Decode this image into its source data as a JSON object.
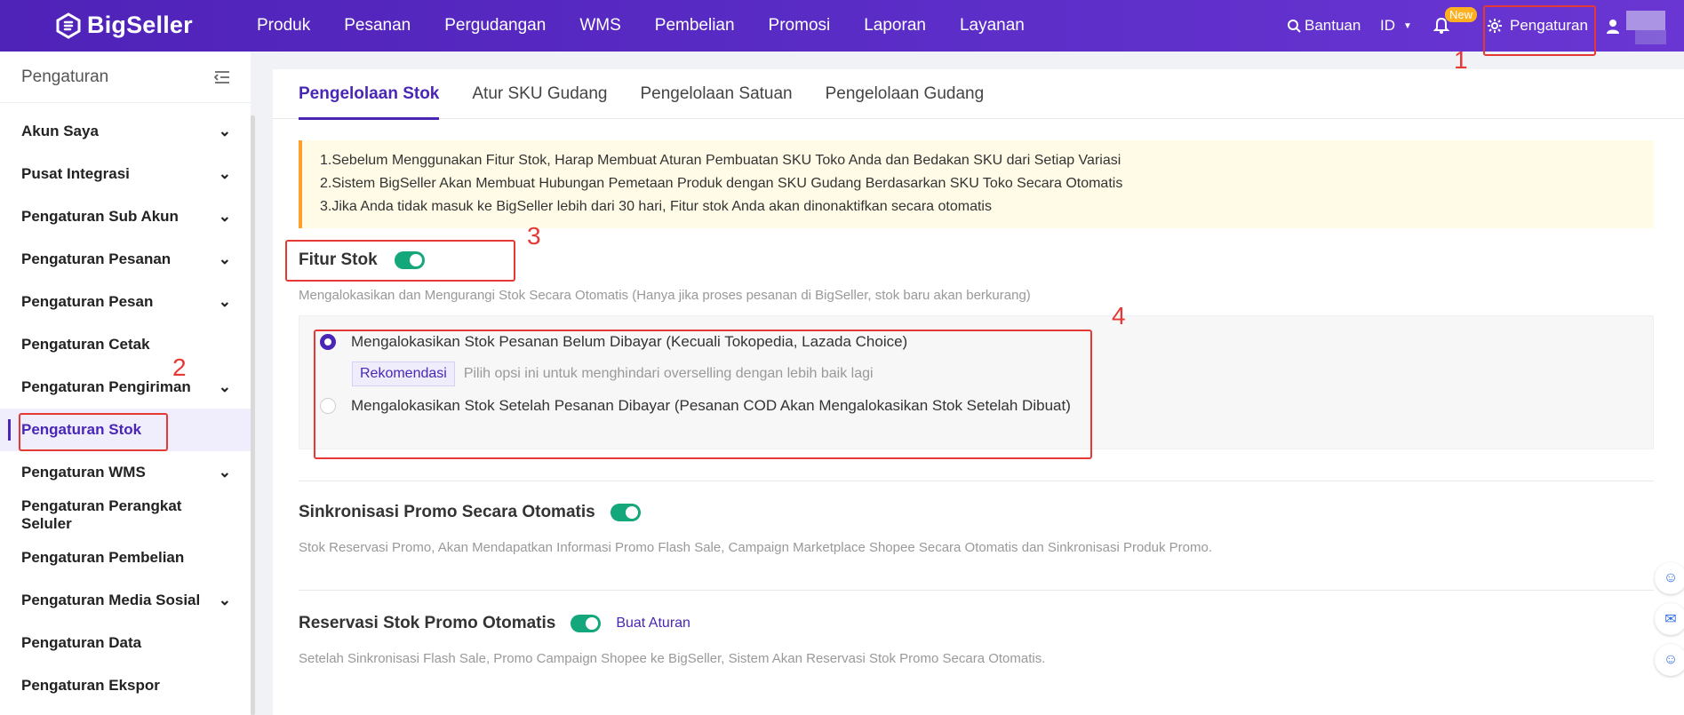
{
  "header": {
    "logo_text": "BigSeller",
    "nav": [
      "Produk",
      "Pesanan",
      "Pergudangan",
      "WMS",
      "Pembelian",
      "Promosi",
      "Laporan",
      "Layanan"
    ],
    "help_label": "Bantuan",
    "language": "ID",
    "new_badge": "New",
    "settings_label": "Pengaturan"
  },
  "sidebar": {
    "title": "Pengaturan",
    "items": [
      {
        "label": "Akun Saya"
      },
      {
        "label": "Pusat Integrasi"
      },
      {
        "label": "Pengaturan Sub Akun"
      },
      {
        "label": "Pengaturan Pesanan"
      },
      {
        "label": "Pengaturan Pesan"
      },
      {
        "label": "Pengaturan Cetak"
      },
      {
        "label": "Pengaturan Pengiriman"
      },
      {
        "label": "Pengaturan Stok"
      },
      {
        "label": "Pengaturan WMS"
      },
      {
        "label": "Pengaturan Perangkat Seluler"
      },
      {
        "label": "Pengaturan Pembelian"
      },
      {
        "label": "Pengaturan Media Sosial"
      },
      {
        "label": "Pengaturan Data"
      },
      {
        "label": "Pengaturan Ekspor"
      }
    ]
  },
  "tabs": [
    "Pengelolaan Stok",
    "Atur SKU Gudang",
    "Pengelolaan Satuan",
    "Pengelolaan Gudang"
  ],
  "notice": [
    "1.Sebelum Menggunakan Fitur Stok, Harap Membuat Aturan Pembuatan SKU Toko Anda dan Bedakan SKU dari Setiap Variasi",
    "2.Sistem BigSeller Akan Membuat Hubungan Pemetaan Produk dengan SKU Gudang Berdasarkan SKU Toko Secara Otomatis",
    "3.Jika Anda tidak masuk ke BigSeller lebih dari 30 hari, Fitur stok Anda akan dinonaktifkan secara otomatis"
  ],
  "stock_feature": {
    "title": "Fitur Stok",
    "description": "Mengalokasikan dan Mengurangi Stok Secara Otomatis (Hanya jika proses pesanan di BigSeller, stok baru akan berkurang)",
    "options": [
      "Mengalokasikan Stok Pesanan Belum Dibayar (Kecuali Tokopedia, Lazada Choice)",
      "Mengalokasikan Stok Setelah Pesanan Dibayar (Pesanan COD Akan Mengalokasikan Stok Setelah Dibuat)"
    ],
    "recommend_badge": "Rekomendasi",
    "recommend_text": "Pilih opsi ini untuk menghindari overselling dengan lebih baik lagi"
  },
  "promo_sync": {
    "title": "Sinkronisasi Promo Secara Otomatis",
    "description": "Stok Reservasi Promo, Akan Mendapatkan Informasi Promo Flash Sale, Campaign Marketplace Shopee Secara Otomatis dan Sinkronisasi Produk Promo."
  },
  "promo_reservation": {
    "title": "Reservasi Stok Promo Otomatis",
    "link": "Buat Aturan",
    "description": "Setelah Sinkronisasi Flash Sale, Promo Campaign Shopee ke BigSeller, Sistem Akan Reservasi Stok Promo Secara Otomatis."
  },
  "annotations": [
    "1",
    "2",
    "3",
    "4"
  ]
}
